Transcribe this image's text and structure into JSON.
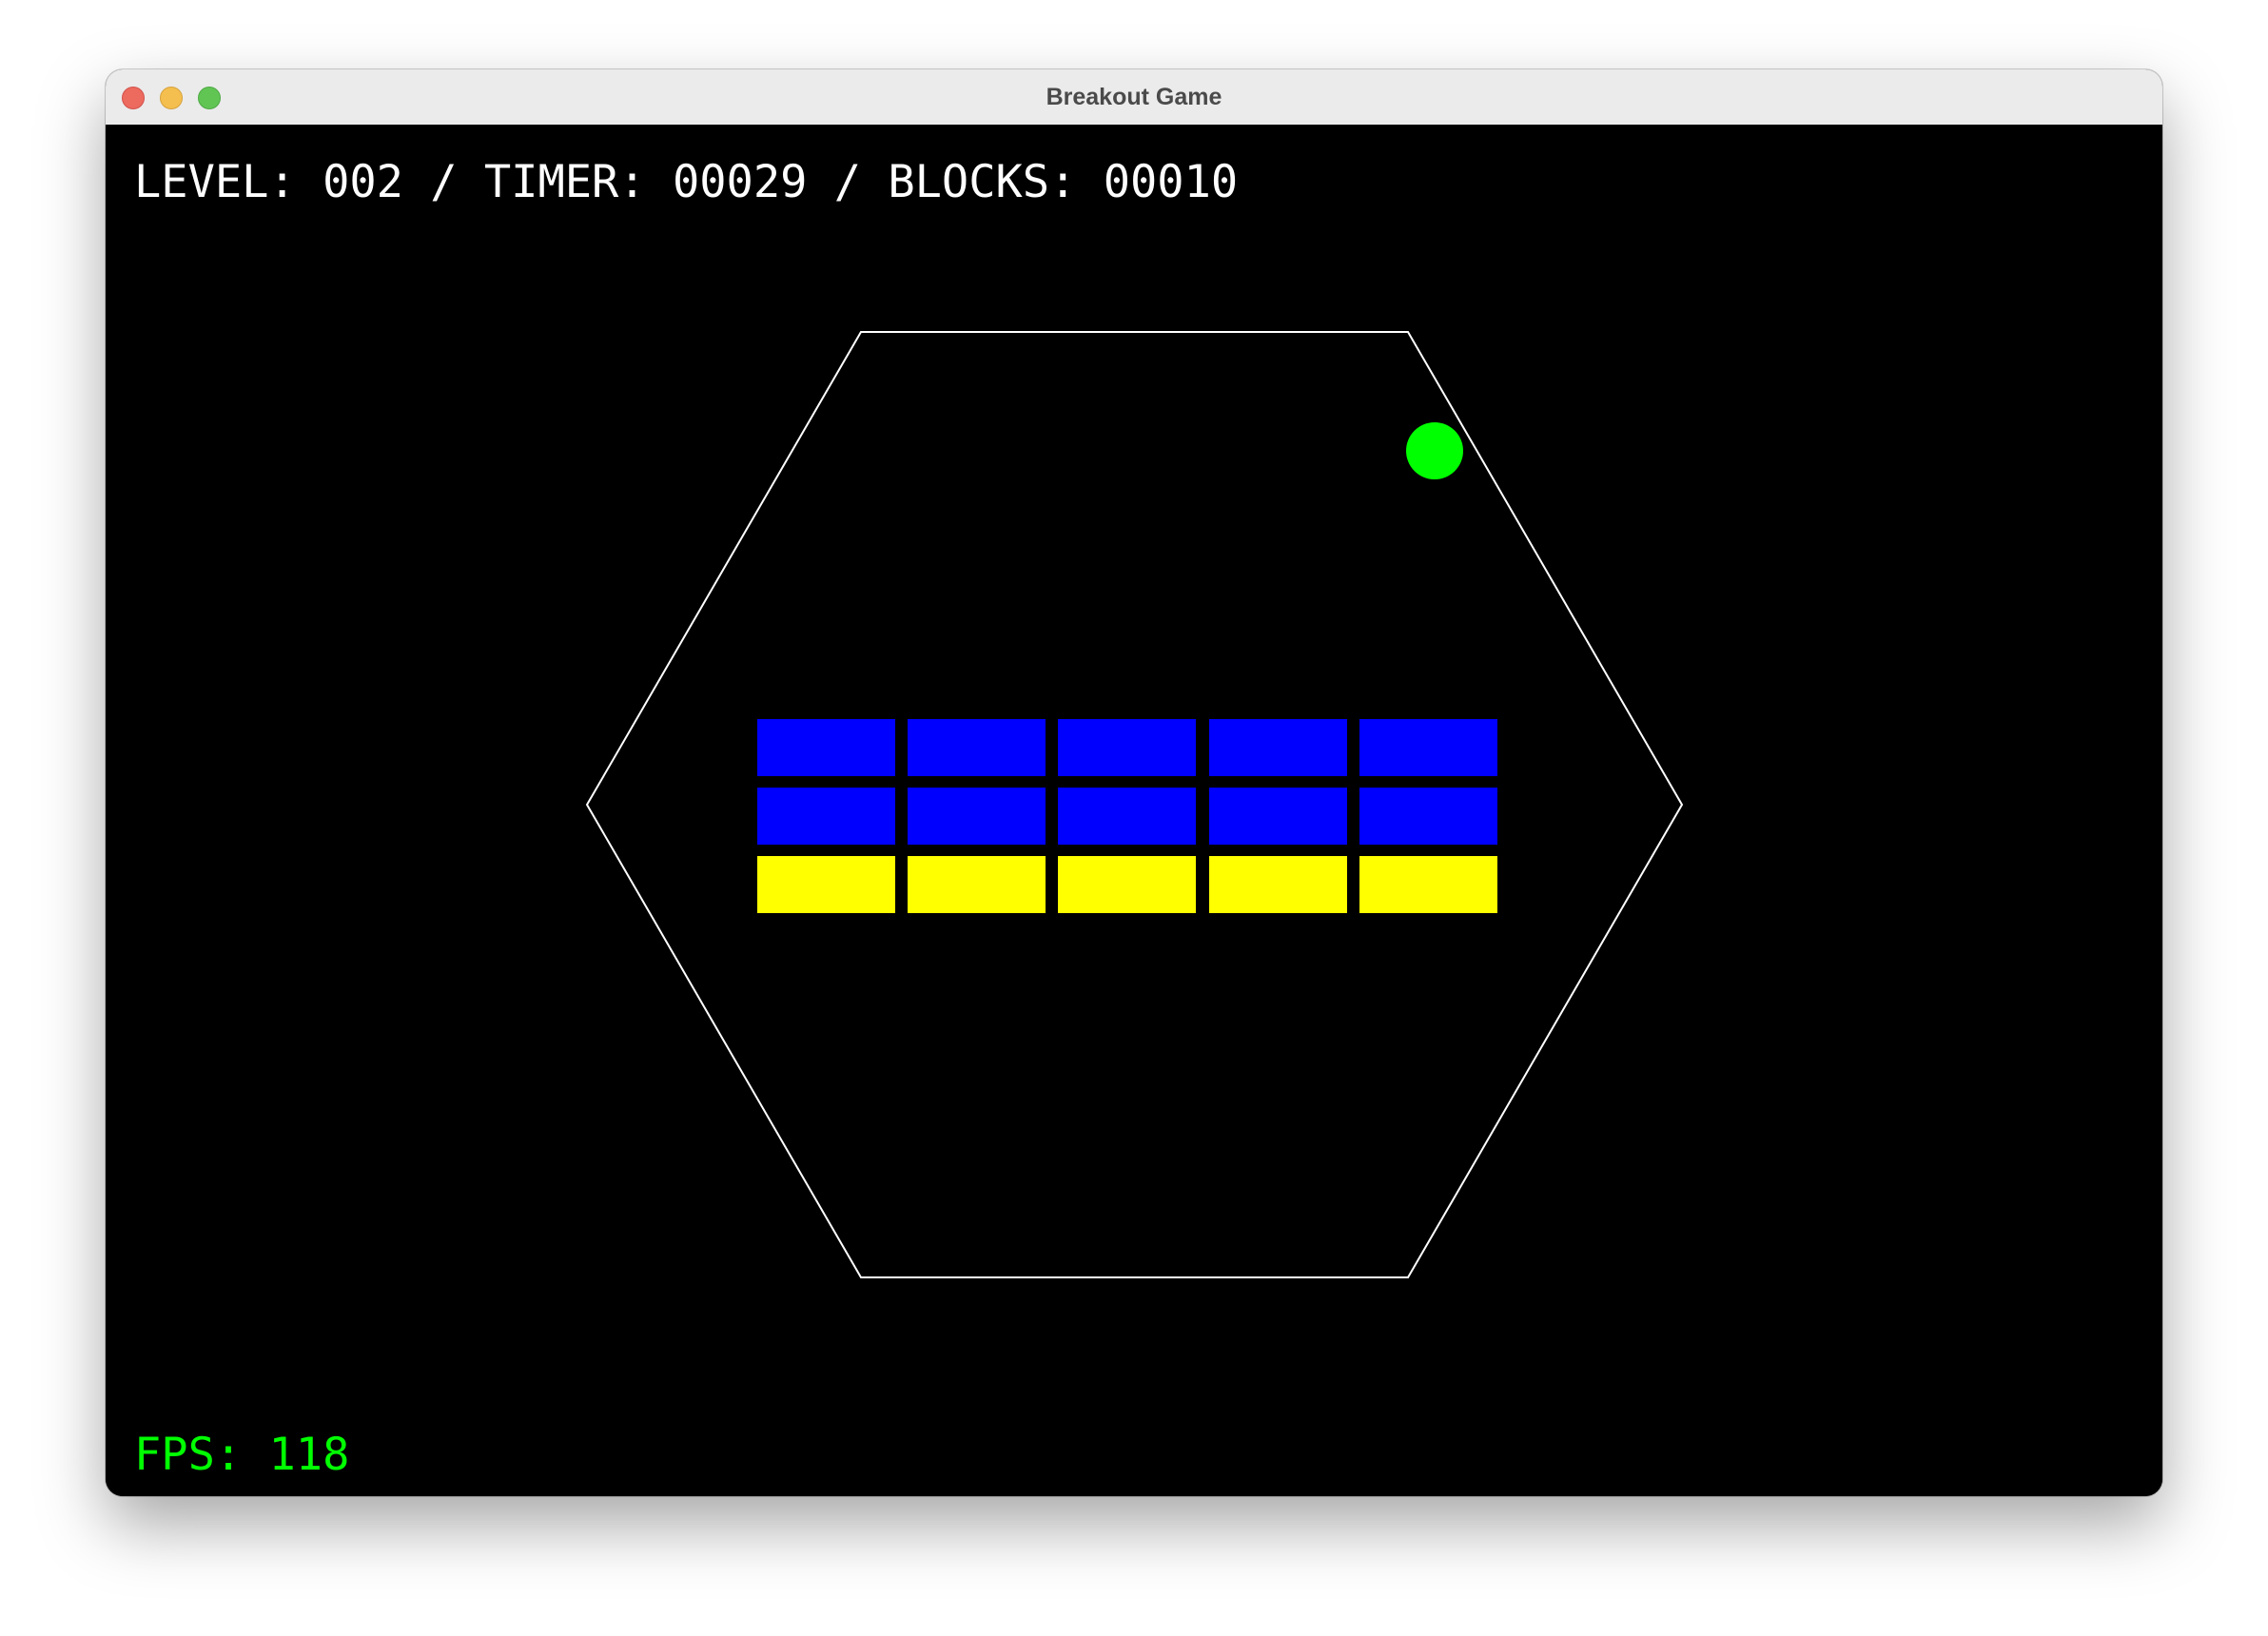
{
  "window": {
    "title": "Breakout Game"
  },
  "hud": {
    "level_label": "LEVEL:",
    "level_value": "002",
    "separator": "/",
    "timer_label": "TIMER:",
    "timer_value": "00029",
    "blocks_label": "BLOCKS:",
    "blocks_value": "00010"
  },
  "fps": {
    "label": "FPS:",
    "value": "118"
  },
  "colors": {
    "background": "#000000",
    "arena_outline": "#ffffff",
    "ball": "#00ff00",
    "block_blue": "#0000ff",
    "block_yellow": "#ffff00",
    "hud_text": "#ffffff",
    "fps_text": "#00ff00"
  },
  "arena": {
    "shape": "hexagon"
  },
  "blocks": {
    "rows": [
      {
        "color": "blue",
        "count": 5
      },
      {
        "color": "blue",
        "count": 5
      },
      {
        "color": "yellow",
        "count": 5
      }
    ]
  },
  "icons": {
    "close": "close-button-icon",
    "minimize": "minimize-button-icon",
    "maximize": "maximize-button-icon"
  }
}
